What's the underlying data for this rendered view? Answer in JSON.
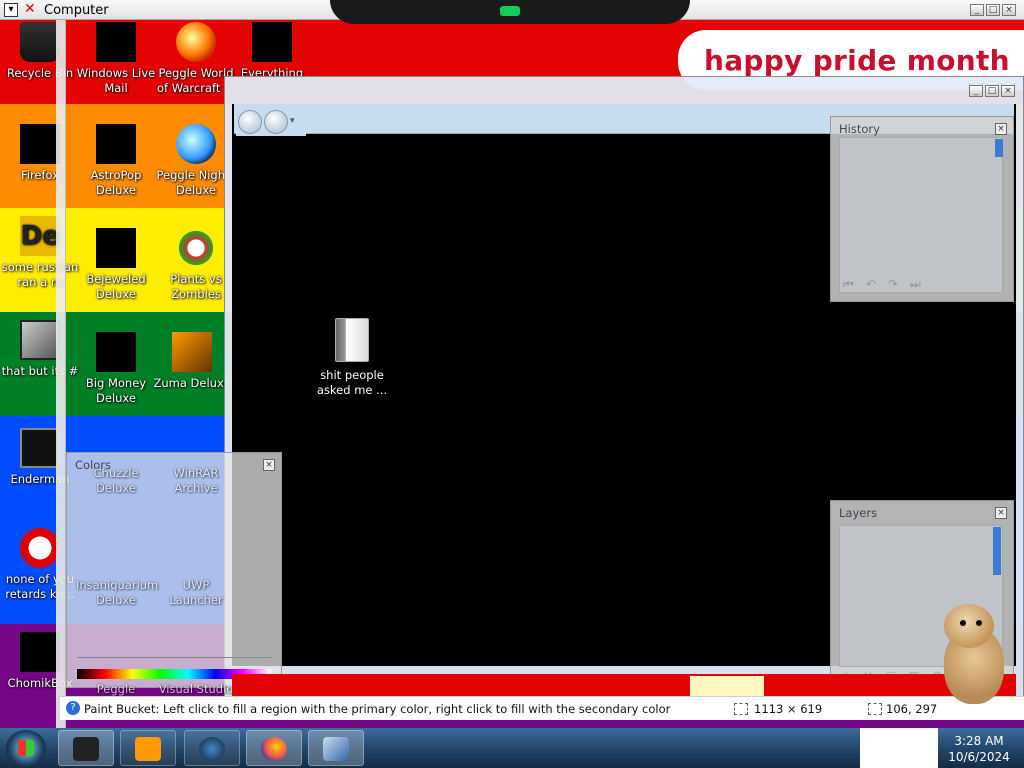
{
  "top_bar": {
    "sys_icon": "window-menu-icon",
    "title": "Computer"
  },
  "wallpaper": {
    "banner": "happy pride month",
    "colors": [
      "#e40303",
      "#ff8c00",
      "#ffed00",
      "#008026",
      "#004dff",
      "#750787"
    ]
  },
  "desktop_icons": [
    {
      "label": "Recycle Bin",
      "icon": "recycle-bin-icon"
    },
    {
      "label": "Windows Live Mail",
      "icon": "mail-icon"
    },
    {
      "label": "Peggle World of Warcraft ...",
      "icon": "peggle-icon"
    },
    {
      "label": "Everything",
      "icon": "search-app-icon"
    },
    {
      "label": "Firefox",
      "icon": "firefox-icon"
    },
    {
      "label": "AstroPop Deluxe",
      "icon": "game-icon"
    },
    {
      "label": "Peggle Nights Deluxe",
      "icon": "peggle-icon"
    },
    {
      "label": "some russian ran a ra",
      "icon": "dk-icon"
    },
    {
      "label": "Bejeweled Deluxe",
      "icon": "game-icon"
    },
    {
      "label": "Plants vs Zombies",
      "icon": "plant-icon"
    },
    {
      "label": "that but its #",
      "icon": "windows-icon"
    },
    {
      "label": "Big Money Deluxe",
      "icon": "money-bag-icon"
    },
    {
      "label": "Zuma Deluxe",
      "icon": "zuma-icon"
    },
    {
      "label": "Enderman",
      "icon": "console-icon"
    },
    {
      "label": "Chuzzle Deluxe",
      "icon": "game-icon"
    },
    {
      "label": "WinRAR Archive",
      "icon": "archive-icon"
    },
    {
      "label": "none of you retards kn...",
      "icon": "dino-icon"
    },
    {
      "label": "Insaniquarium Deluxe",
      "icon": "game-icon"
    },
    {
      "label": "UWP Launcher",
      "icon": "app-icon"
    },
    {
      "label": "ChomikBox",
      "icon": "hamster-icon"
    },
    {
      "label": "Peggle Deluxe",
      "icon": "peggle-icon"
    },
    {
      "label": "Visual Studio",
      "icon": "vs-icon"
    }
  ],
  "paint_window": {
    "title_controls": [
      "_",
      "□",
      "×"
    ],
    "toolbar_buttons": [
      "back",
      "forward"
    ],
    "canvas_folder": {
      "label": "shit people asked me ...",
      "icon": "folder-icon"
    }
  },
  "panels": {
    "history": {
      "title": "History",
      "close": "×",
      "nav": [
        "⏮",
        "↶",
        "↷",
        "⏭"
      ]
    },
    "layers": {
      "title": "Layers",
      "close": "×",
      "nav": [
        "+",
        "✕",
        "▤",
        "▦",
        "⚙"
      ]
    },
    "colors": {
      "title": "Colors",
      "close": "×"
    }
  },
  "status_bar": {
    "tool_hint": "Paint Bucket: Left click to fill a region with the primary color, right click to fill with the secondary color",
    "image_size": "1113 × 619",
    "cursor_position": "106, 297"
  },
  "taskbar": {
    "apps": [
      "terminal-icon",
      "media-player-icon",
      "globe-icon",
      "firefox-icon",
      "paint-net-icon"
    ],
    "clock_time": "3:28 AM",
    "clock_date": "10/6/2024"
  }
}
